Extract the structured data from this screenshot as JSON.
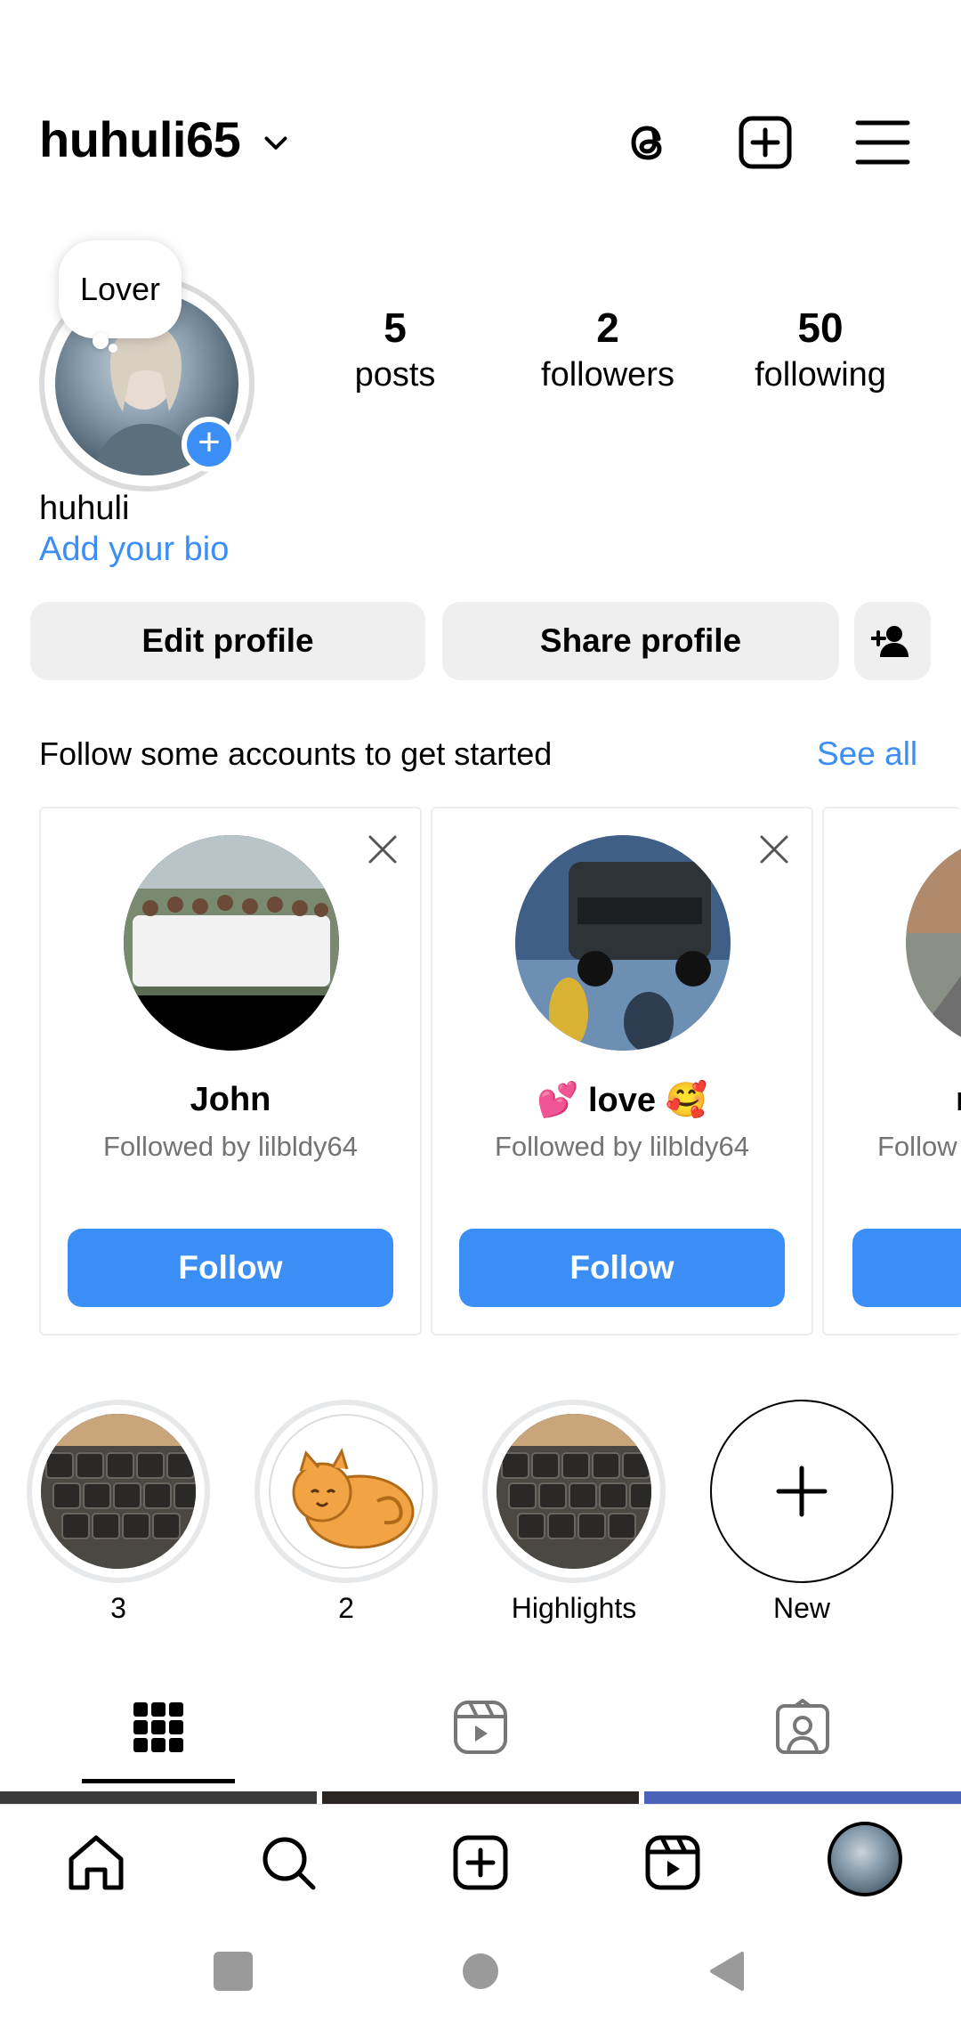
{
  "header": {
    "username": "huhuli65"
  },
  "profile": {
    "note": "Lover",
    "stats": [
      {
        "value": "5",
        "label": "posts"
      },
      {
        "value": "2",
        "label": "followers"
      },
      {
        "value": "50",
        "label": "following"
      }
    ],
    "full_name": "huhuli",
    "bio_link": "Add your bio",
    "edit_label": "Edit profile",
    "share_label": "Share profile"
  },
  "suggestions": {
    "title": "Follow some accounts to get started",
    "see_all": "See all",
    "cards": [
      {
        "name": "John",
        "sub": "Followed by lilbldy64",
        "button": "Follow"
      },
      {
        "name": "💕 love 🥰",
        "sub": "Followed by lilbldy64",
        "button": "Follow"
      },
      {
        "name": "r",
        "sub": "Follow",
        "button": ""
      }
    ]
  },
  "highlights": [
    {
      "label": "3"
    },
    {
      "label": "2"
    },
    {
      "label": "Highlights"
    },
    {
      "label": "New"
    }
  ],
  "colors": {
    "accent": "#3a8ef6",
    "muted": "#737373",
    "button_gray": "#efefef"
  }
}
